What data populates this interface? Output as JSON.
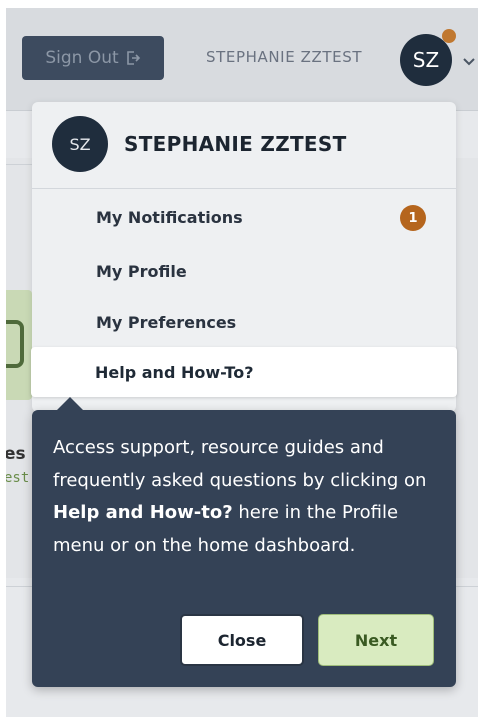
{
  "header": {
    "sign_out_label": "Sign Out",
    "sign_out_icon": "sign-out-icon",
    "user_name": "STEPHANIE ZZTEST",
    "avatar_initials": "SZ",
    "notification_dot_color": "#c07830",
    "chevron_icon": "chevron-down-icon"
  },
  "background": {
    "fragment_1": "es",
    "fragment_2": "est"
  },
  "profile_menu": {
    "avatar_initials": "SZ",
    "user_name": "STEPHANIE ZZTEST",
    "items": [
      {
        "label": "My Notifications",
        "badge": "1"
      },
      {
        "label": "My Profile"
      },
      {
        "label": "My Preferences"
      },
      {
        "label": "Help and How-To?",
        "active": true
      }
    ]
  },
  "tooltip": {
    "text_before": "Access support, resource guides and frequently asked questions by clicking on ",
    "text_bold": "Help and How-to?",
    "text_after": " here in the Profile menu or on the home dashboard.",
    "close_label": "Close",
    "next_label": "Next"
  },
  "colors": {
    "tooltip_bg": "#344256",
    "next_button_bg": "#d9ebc0",
    "badge": "#b5651d",
    "avatar_bg": "#1f2d3d"
  }
}
